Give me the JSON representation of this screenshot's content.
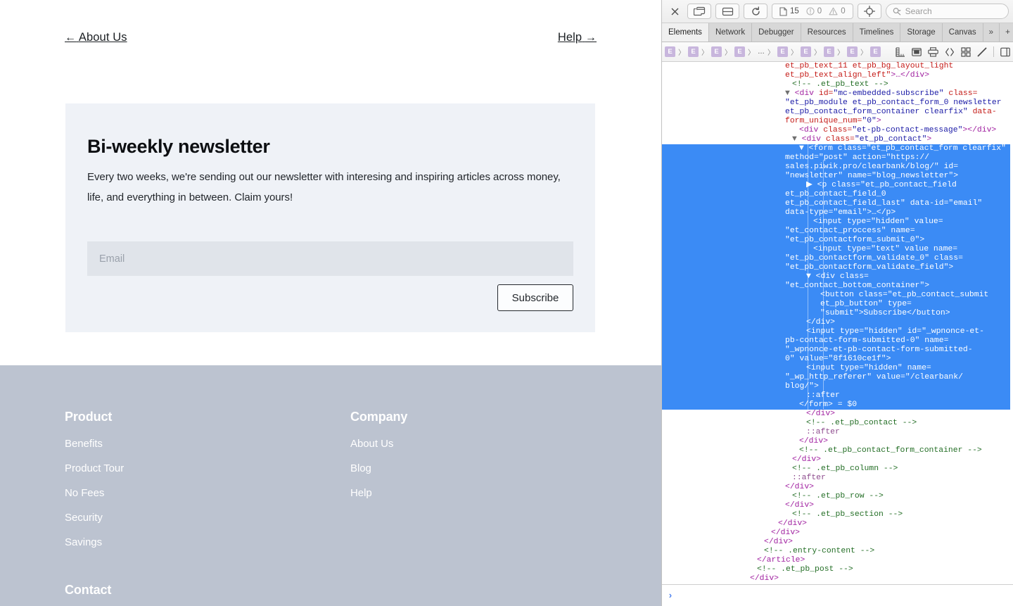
{
  "webpage": {
    "pager": {
      "prev_arrow": "←",
      "prev_label": "About Us",
      "next_label": "Help",
      "next_arrow": "→"
    },
    "newsletter": {
      "title": "Bi-weekly newsletter",
      "description": "Every two weeks, we're sending out our newsletter with interesing and inspiring articles across money, life, and everything in between. Claim yours!",
      "email_placeholder": "Email",
      "email_value": "",
      "submit_label": "Subscribe"
    },
    "footer": {
      "columns": [
        {
          "heading": "Product",
          "links": [
            "Benefits",
            "Product Tour",
            "No Fees",
            "Security",
            "Savings"
          ]
        },
        {
          "heading": "Company",
          "links": [
            "About Us",
            "Blog",
            "Help"
          ]
        }
      ],
      "contact_heading": "Contact"
    },
    "colors": {
      "card_bg": "#eff2f7",
      "input_bg": "#e0e4ea",
      "footer_bg": "#bcc3d0"
    }
  },
  "inspector": {
    "toolbar": {
      "close_icon": "close-icon",
      "dock_icon": "dock-window-icon",
      "layout_icon": "dock-bottom-icon",
      "reload_icon": "reload-icon",
      "resources_count": "15",
      "errors_count": "0",
      "warnings_count": "0",
      "inspect_icon": "inspect-target-icon",
      "search_placeholder": "Search",
      "search_value": ""
    },
    "tabs": [
      {
        "label": "Elements",
        "selected": true
      },
      {
        "label": "Network",
        "selected": false
      },
      {
        "label": "Debugger",
        "selected": false
      },
      {
        "label": "Resources",
        "selected": false
      },
      {
        "label": "Timelines",
        "selected": false
      },
      {
        "label": "Storage",
        "selected": false
      },
      {
        "label": "Canvas",
        "selected": false
      }
    ],
    "tab_overflow": "»",
    "tab_add": "+",
    "tab_settings": "gear-icon",
    "breadcrumb": {
      "badges": [
        "E",
        "E",
        "E",
        "E",
        "E",
        "E",
        "E",
        "E",
        "E"
      ],
      "ellipsis": "…",
      "separator": "〉",
      "tools": [
        "ruler-icon",
        "box-model-icon",
        "print-styles-icon",
        "code-brackets-icon",
        "grid-overlay-icon",
        "edit-brush-icon",
        "toggle-sidebar-icon"
      ]
    },
    "console_prompt": "›",
    "selection_color": "#3b8bf5",
    "dom_lines": [
      {
        "indent": 0,
        "sel": false,
        "tokens": [
          {
            "c": "t-attr",
            "t": "et_pb_text_11 et_pb_bg_layout_light"
          }
        ]
      },
      {
        "indent": 0,
        "sel": false,
        "tokens": [
          {
            "c": "t-attr",
            "t": "et_pb_text_align_left\""
          },
          {
            "c": "t-tag",
            "t": ">…</div>"
          }
        ]
      },
      {
        "indent": 1,
        "sel": false,
        "tokens": [
          {
            "c": "t-com",
            "t": "<!-- .et_pb_text -->"
          }
        ]
      },
      {
        "indent": 0,
        "sel": false,
        "tokens": [
          {
            "c": "arrowg",
            "t": "▼ "
          },
          {
            "c": "t-tag",
            "t": "<div "
          },
          {
            "c": "t-attr",
            "t": "id="
          },
          {
            "c": "t-val",
            "t": "\"mc-embedded-subscribe\""
          },
          {
            "c": "t-attr",
            "t": " class="
          }
        ]
      },
      {
        "indent": 0,
        "sel": false,
        "tokens": [
          {
            "c": "t-val",
            "t": "\"et_pb_module et_pb_contact_form_0 newsletter"
          }
        ]
      },
      {
        "indent": 0,
        "sel": false,
        "tokens": [
          {
            "c": "t-val",
            "t": "et_pb_contact_form_container clearfix\""
          },
          {
            "c": "t-attr",
            "t": " data-"
          }
        ]
      },
      {
        "indent": 0,
        "sel": false,
        "tokens": [
          {
            "c": "t-attr",
            "t": "form_unique_num="
          },
          {
            "c": "t-val",
            "t": "\"0\""
          },
          {
            "c": "t-tag",
            "t": ">"
          }
        ]
      },
      {
        "indent": 2,
        "sel": false,
        "tokens": [
          {
            "c": "t-tag",
            "t": "<div "
          },
          {
            "c": "t-attr",
            "t": "class="
          },
          {
            "c": "t-val",
            "t": "\"et-pb-contact-message\""
          },
          {
            "c": "t-tag",
            "t": "></div>"
          }
        ]
      },
      {
        "indent": 1,
        "sel": false,
        "tokens": [
          {
            "c": "arrowg",
            "t": "▼ "
          },
          {
            "c": "t-tag",
            "t": "<div "
          },
          {
            "c": "t-attr",
            "t": "class="
          },
          {
            "c": "t-val",
            "t": "\"et_pb_contact\""
          },
          {
            "c": "t-tag",
            "t": ">"
          }
        ]
      },
      {
        "indent": 2,
        "sel": true,
        "tokens": [
          {
            "c": "arrowg",
            "t": "▼ "
          },
          {
            "c": "t-tag",
            "t": "<form "
          },
          {
            "c": "t-attr",
            "t": "class="
          },
          {
            "c": "t-val",
            "t": "\"et_pb_contact_form clearfix\""
          }
        ]
      },
      {
        "indent": 0,
        "sel": true,
        "tokens": [
          {
            "c": "t-attr",
            "t": "method="
          },
          {
            "c": "t-val",
            "t": "\"post\""
          },
          {
            "c": "t-attr",
            "t": " action="
          },
          {
            "c": "t-val",
            "t": "\"https://"
          }
        ]
      },
      {
        "indent": 0,
        "sel": true,
        "tokens": [
          {
            "c": "t-val",
            "t": "sales.piwik.pro/clearbank/blog/\""
          },
          {
            "c": "t-attr",
            "t": " id="
          }
        ]
      },
      {
        "indent": 0,
        "sel": true,
        "tokens": [
          {
            "c": "t-val",
            "t": "\"newsletter\""
          },
          {
            "c": "t-attr",
            "t": " name="
          },
          {
            "c": "t-val",
            "t": "\"blog_newsletter\""
          },
          {
            "c": "t-tag",
            "t": ">"
          }
        ]
      },
      {
        "indent": 3,
        "sel": true,
        "tokens": [
          {
            "c": "arrowg",
            "t": "▶ "
          },
          {
            "c": "t-tag",
            "t": "<p "
          },
          {
            "c": "t-attr",
            "t": "class="
          },
          {
            "c": "t-val",
            "t": "\"et_pb_contact_field"
          }
        ]
      },
      {
        "indent": 0,
        "sel": true,
        "tokens": [
          {
            "c": "t-val",
            "t": "et_pb_contact_field_0"
          }
        ]
      },
      {
        "indent": 0,
        "sel": true,
        "tokens": [
          {
            "c": "t-val",
            "t": "et_pb_contact_field_last\""
          },
          {
            "c": "t-attr",
            "t": " data-id="
          },
          {
            "c": "t-val",
            "t": "\"email\""
          }
        ]
      },
      {
        "indent": 0,
        "sel": true,
        "tokens": [
          {
            "c": "t-attr",
            "t": "data-type="
          },
          {
            "c": "t-val",
            "t": "\"email\""
          },
          {
            "c": "t-tag",
            "t": ">…</p>"
          }
        ]
      },
      {
        "indent": 4,
        "sel": true,
        "tokens": [
          {
            "c": "t-tag",
            "t": "<input "
          },
          {
            "c": "t-attr",
            "t": "type="
          },
          {
            "c": "t-val",
            "t": "\"hidden\""
          },
          {
            "c": "t-attr",
            "t": " value="
          }
        ]
      },
      {
        "indent": 0,
        "sel": true,
        "tokens": [
          {
            "c": "t-val",
            "t": "\"et_contact_proccess\""
          },
          {
            "c": "t-attr",
            "t": " name="
          }
        ]
      },
      {
        "indent": 0,
        "sel": true,
        "tokens": [
          {
            "c": "t-val",
            "t": "\"et_pb_contactform_submit_0\""
          },
          {
            "c": "t-tag",
            "t": ">"
          }
        ]
      },
      {
        "indent": 4,
        "sel": true,
        "tokens": [
          {
            "c": "t-tag",
            "t": "<input "
          },
          {
            "c": "t-attr",
            "t": "type="
          },
          {
            "c": "t-val",
            "t": "\"text\""
          },
          {
            "c": "t-attr",
            "t": " value name="
          }
        ]
      },
      {
        "indent": 0,
        "sel": true,
        "tokens": [
          {
            "c": "t-val",
            "t": "\"et_pb_contactform_validate_0\""
          },
          {
            "c": "t-attr",
            "t": " class="
          }
        ]
      },
      {
        "indent": 0,
        "sel": true,
        "tokens": [
          {
            "c": "t-val",
            "t": "\"et_pb_contactform_validate_field\""
          },
          {
            "c": "t-tag",
            "t": ">"
          }
        ]
      },
      {
        "indent": 3,
        "sel": true,
        "tokens": [
          {
            "c": "arrowg",
            "t": "▼ "
          },
          {
            "c": "t-tag",
            "t": "<div "
          },
          {
            "c": "t-attr",
            "t": "class="
          }
        ]
      },
      {
        "indent": 0,
        "sel": true,
        "tokens": [
          {
            "c": "t-val",
            "t": "\"et_contact_bottom_container\""
          },
          {
            "c": "t-tag",
            "t": ">"
          }
        ]
      },
      {
        "indent": 5,
        "sel": true,
        "tokens": [
          {
            "c": "t-tag",
            "t": "<button "
          },
          {
            "c": "t-attr",
            "t": "class="
          },
          {
            "c": "t-val",
            "t": "\"et_pb_contact_submit"
          }
        ]
      },
      {
        "indent": 5,
        "sel": true,
        "tokens": [
          {
            "c": "t-val",
            "t": "et_pb_button\""
          },
          {
            "c": "t-attr",
            "t": " type="
          }
        ]
      },
      {
        "indent": 5,
        "sel": true,
        "tokens": [
          {
            "c": "t-val",
            "t": "\"submit\""
          },
          {
            "c": "t-tag",
            "t": ">"
          },
          {
            "c": "t-txt",
            "t": "Subscribe"
          },
          {
            "c": "t-tag",
            "t": "</button>"
          }
        ]
      },
      {
        "indent": 3,
        "sel": true,
        "tokens": [
          {
            "c": "t-tag",
            "t": "</div>"
          }
        ]
      },
      {
        "indent": 3,
        "sel": true,
        "tokens": [
          {
            "c": "t-tag",
            "t": "<input "
          },
          {
            "c": "t-attr",
            "t": "type="
          },
          {
            "c": "t-val",
            "t": "\"hidden\""
          },
          {
            "c": "t-attr",
            "t": " id="
          },
          {
            "c": "t-val",
            "t": "\"_wpnonce-et-"
          }
        ]
      },
      {
        "indent": 0,
        "sel": true,
        "tokens": [
          {
            "c": "t-val",
            "t": "pb-contact-form-submitted-0\""
          },
          {
            "c": "t-attr",
            "t": " name="
          }
        ]
      },
      {
        "indent": 0,
        "sel": true,
        "tokens": [
          {
            "c": "t-val",
            "t": "\"_wpnonce-et-pb-contact-form-submitted-"
          }
        ]
      },
      {
        "indent": 0,
        "sel": true,
        "tokens": [
          {
            "c": "t-val",
            "t": "0\""
          },
          {
            "c": "t-attr",
            "t": " value="
          },
          {
            "c": "t-val",
            "t": "\"8f1610ce1f\""
          },
          {
            "c": "t-tag",
            "t": ">"
          }
        ]
      },
      {
        "indent": 3,
        "sel": true,
        "tokens": [
          {
            "c": "t-tag",
            "t": "<input "
          },
          {
            "c": "t-attr",
            "t": "type="
          },
          {
            "c": "t-val",
            "t": "\"hidden\""
          },
          {
            "c": "t-attr",
            "t": " name="
          }
        ]
      },
      {
        "indent": 0,
        "sel": true,
        "tokens": [
          {
            "c": "t-val",
            "t": "\"_wp_http_referer\""
          },
          {
            "c": "t-attr",
            "t": " value="
          },
          {
            "c": "t-val",
            "t": "\"/clearbank/"
          }
        ]
      },
      {
        "indent": 0,
        "sel": true,
        "tokens": [
          {
            "c": "t-val",
            "t": "blog/\""
          },
          {
            "c": "t-tag",
            "t": ">"
          }
        ]
      },
      {
        "indent": 3,
        "sel": true,
        "tokens": [
          {
            "c": "t-ps",
            "t": "::after"
          }
        ]
      },
      {
        "indent": 2,
        "sel": true,
        "tokens": [
          {
            "c": "t-tag",
            "t": "</form>"
          },
          {
            "c": "t-txt",
            "t": " = "
          },
          {
            "c": "t-num",
            "t": "$0"
          }
        ]
      },
      {
        "indent": 3,
        "sel": false,
        "tokens": [
          {
            "c": "t-tag",
            "t": "</div>"
          }
        ]
      },
      {
        "indent": 3,
        "sel": false,
        "tokens": [
          {
            "c": "t-com",
            "t": "<!-- .et_pb_contact -->"
          }
        ]
      },
      {
        "indent": 3,
        "sel": false,
        "tokens": [
          {
            "c": "t-ps",
            "t": "::after"
          }
        ]
      },
      {
        "indent": 2,
        "sel": false,
        "tokens": [
          {
            "c": "t-tag",
            "t": "</div>"
          }
        ]
      },
      {
        "indent": 2,
        "sel": false,
        "tokens": [
          {
            "c": "t-com",
            "t": "<!-- .et_pb_contact_form_container -->"
          }
        ]
      },
      {
        "indent": 1,
        "sel": false,
        "tokens": [
          {
            "c": "t-tag",
            "t": "</div>"
          }
        ]
      },
      {
        "indent": 1,
        "sel": false,
        "tokens": [
          {
            "c": "t-com",
            "t": "<!-- .et_pb_column -->"
          }
        ]
      },
      {
        "indent": 1,
        "sel": false,
        "tokens": [
          {
            "c": "t-ps",
            "t": "::after"
          }
        ]
      },
      {
        "indent": 0,
        "sel": false,
        "tokens": [
          {
            "c": "t-tag",
            "t": "</div>"
          }
        ]
      },
      {
        "indent": 1,
        "sel": false,
        "tokens": [
          {
            "c": "t-com",
            "t": "<!-- .et_pb_row -->"
          }
        ]
      },
      {
        "indent": 0,
        "sel": false,
        "tokens": [
          {
            "c": "t-tag",
            "t": "</div>"
          }
        ]
      },
      {
        "indent": 1,
        "sel": false,
        "tokens": [
          {
            "c": "t-com",
            "t": "<!-- .et_pb_section -->"
          }
        ]
      },
      {
        "indent": -1,
        "sel": false,
        "tokens": [
          {
            "c": "t-tag",
            "t": "</div>"
          }
        ]
      },
      {
        "indent": -2,
        "sel": false,
        "tokens": [
          {
            "c": "t-tag",
            "t": "</div>"
          }
        ]
      },
      {
        "indent": -3,
        "sel": false,
        "tokens": [
          {
            "c": "t-tag",
            "t": "</div>"
          }
        ]
      },
      {
        "indent": -3,
        "sel": false,
        "tokens": [
          {
            "c": "t-com",
            "t": "<!-- .entry-content -->"
          }
        ]
      },
      {
        "indent": -4,
        "sel": false,
        "tokens": [
          {
            "c": "t-tag",
            "t": "</article>"
          }
        ]
      },
      {
        "indent": -4,
        "sel": false,
        "tokens": [
          {
            "c": "t-com",
            "t": "<!-- .et_pb_post -->"
          }
        ]
      },
      {
        "indent": -5,
        "sel": false,
        "tokens": [
          {
            "c": "t-tag",
            "t": "</div>"
          }
        ]
      }
    ]
  }
}
